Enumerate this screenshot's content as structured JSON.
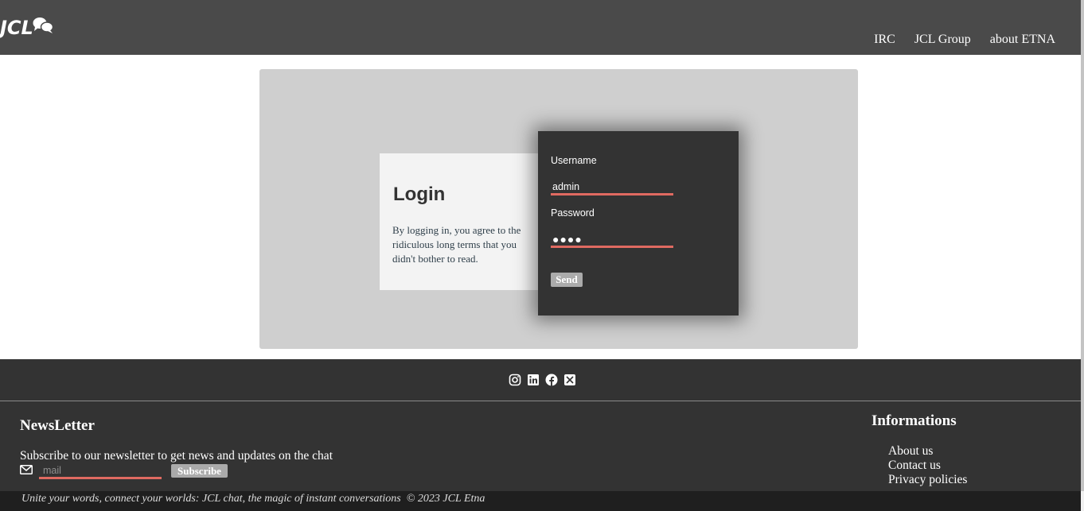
{
  "header": {
    "logo_text": "JCL",
    "nav": [
      {
        "label": "IRC"
      },
      {
        "label": "JCL Group"
      },
      {
        "label": "about ETNA"
      }
    ]
  },
  "intro": {
    "title": "Login",
    "text": "By logging in, you agree to the ridiculous long terms that you didn't bother to read."
  },
  "login_form": {
    "username_label": "Username",
    "username_value": "admin",
    "password_label": "Password",
    "password_display": "●●●●",
    "send_label": "Send"
  },
  "footer": {
    "social_icons": [
      "instagram-icon",
      "linkedin-icon",
      "facebook-icon",
      "x-icon"
    ],
    "newsletter": {
      "title": "NewsLetter",
      "text": "Subscribe to our newsletter to get news and updates on the chat",
      "mail_placeholder": "mail",
      "subscribe_label": "Subscribe"
    },
    "informations": {
      "title": "Informations",
      "links": [
        {
          "label": "About us"
        },
        {
          "label": "Contact us"
        },
        {
          "label": "Privacy policies"
        }
      ]
    },
    "tagline": "Unite your words, connect your worlds: JCL chat, the magic of instant conversations  © 2023 JCL Etna"
  },
  "colors": {
    "header_bg": "#4a4a4a",
    "panel_bg": "#cfcfcf",
    "login_bg": "#333333",
    "accent_underline": "#e06a61",
    "footer_bg": "#333333",
    "bottom_bar_bg": "#1f1f1f",
    "button_bg": "#ababab"
  }
}
